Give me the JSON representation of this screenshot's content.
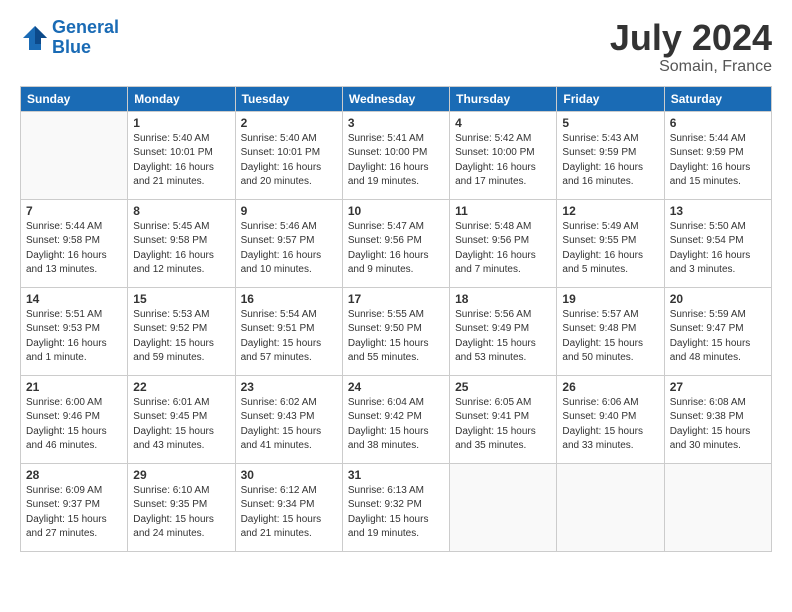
{
  "header": {
    "logo_line1": "General",
    "logo_line2": "Blue",
    "month_year": "July 2024",
    "location": "Somain, France"
  },
  "weekdays": [
    "Sunday",
    "Monday",
    "Tuesday",
    "Wednesday",
    "Thursday",
    "Friday",
    "Saturday"
  ],
  "weeks": [
    [
      {
        "day": "",
        "info": ""
      },
      {
        "day": "1",
        "info": "Sunrise: 5:40 AM\nSunset: 10:01 PM\nDaylight: 16 hours\nand 21 minutes."
      },
      {
        "day": "2",
        "info": "Sunrise: 5:40 AM\nSunset: 10:01 PM\nDaylight: 16 hours\nand 20 minutes."
      },
      {
        "day": "3",
        "info": "Sunrise: 5:41 AM\nSunset: 10:00 PM\nDaylight: 16 hours\nand 19 minutes."
      },
      {
        "day": "4",
        "info": "Sunrise: 5:42 AM\nSunset: 10:00 PM\nDaylight: 16 hours\nand 17 minutes."
      },
      {
        "day": "5",
        "info": "Sunrise: 5:43 AM\nSunset: 9:59 PM\nDaylight: 16 hours\nand 16 minutes."
      },
      {
        "day": "6",
        "info": "Sunrise: 5:44 AM\nSunset: 9:59 PM\nDaylight: 16 hours\nand 15 minutes."
      }
    ],
    [
      {
        "day": "7",
        "info": "Sunrise: 5:44 AM\nSunset: 9:58 PM\nDaylight: 16 hours\nand 13 minutes."
      },
      {
        "day": "8",
        "info": "Sunrise: 5:45 AM\nSunset: 9:58 PM\nDaylight: 16 hours\nand 12 minutes."
      },
      {
        "day": "9",
        "info": "Sunrise: 5:46 AM\nSunset: 9:57 PM\nDaylight: 16 hours\nand 10 minutes."
      },
      {
        "day": "10",
        "info": "Sunrise: 5:47 AM\nSunset: 9:56 PM\nDaylight: 16 hours\nand 9 minutes."
      },
      {
        "day": "11",
        "info": "Sunrise: 5:48 AM\nSunset: 9:56 PM\nDaylight: 16 hours\nand 7 minutes."
      },
      {
        "day": "12",
        "info": "Sunrise: 5:49 AM\nSunset: 9:55 PM\nDaylight: 16 hours\nand 5 minutes."
      },
      {
        "day": "13",
        "info": "Sunrise: 5:50 AM\nSunset: 9:54 PM\nDaylight: 16 hours\nand 3 minutes."
      }
    ],
    [
      {
        "day": "14",
        "info": "Sunrise: 5:51 AM\nSunset: 9:53 PM\nDaylight: 16 hours\nand 1 minute."
      },
      {
        "day": "15",
        "info": "Sunrise: 5:53 AM\nSunset: 9:52 PM\nDaylight: 15 hours\nand 59 minutes."
      },
      {
        "day": "16",
        "info": "Sunrise: 5:54 AM\nSunset: 9:51 PM\nDaylight: 15 hours\nand 57 minutes."
      },
      {
        "day": "17",
        "info": "Sunrise: 5:55 AM\nSunset: 9:50 PM\nDaylight: 15 hours\nand 55 minutes."
      },
      {
        "day": "18",
        "info": "Sunrise: 5:56 AM\nSunset: 9:49 PM\nDaylight: 15 hours\nand 53 minutes."
      },
      {
        "day": "19",
        "info": "Sunrise: 5:57 AM\nSunset: 9:48 PM\nDaylight: 15 hours\nand 50 minutes."
      },
      {
        "day": "20",
        "info": "Sunrise: 5:59 AM\nSunset: 9:47 PM\nDaylight: 15 hours\nand 48 minutes."
      }
    ],
    [
      {
        "day": "21",
        "info": "Sunrise: 6:00 AM\nSunset: 9:46 PM\nDaylight: 15 hours\nand 46 minutes."
      },
      {
        "day": "22",
        "info": "Sunrise: 6:01 AM\nSunset: 9:45 PM\nDaylight: 15 hours\nand 43 minutes."
      },
      {
        "day": "23",
        "info": "Sunrise: 6:02 AM\nSunset: 9:43 PM\nDaylight: 15 hours\nand 41 minutes."
      },
      {
        "day": "24",
        "info": "Sunrise: 6:04 AM\nSunset: 9:42 PM\nDaylight: 15 hours\nand 38 minutes."
      },
      {
        "day": "25",
        "info": "Sunrise: 6:05 AM\nSunset: 9:41 PM\nDaylight: 15 hours\nand 35 minutes."
      },
      {
        "day": "26",
        "info": "Sunrise: 6:06 AM\nSunset: 9:40 PM\nDaylight: 15 hours\nand 33 minutes."
      },
      {
        "day": "27",
        "info": "Sunrise: 6:08 AM\nSunset: 9:38 PM\nDaylight: 15 hours\nand 30 minutes."
      }
    ],
    [
      {
        "day": "28",
        "info": "Sunrise: 6:09 AM\nSunset: 9:37 PM\nDaylight: 15 hours\nand 27 minutes."
      },
      {
        "day": "29",
        "info": "Sunrise: 6:10 AM\nSunset: 9:35 PM\nDaylight: 15 hours\nand 24 minutes."
      },
      {
        "day": "30",
        "info": "Sunrise: 6:12 AM\nSunset: 9:34 PM\nDaylight: 15 hours\nand 21 minutes."
      },
      {
        "day": "31",
        "info": "Sunrise: 6:13 AM\nSunset: 9:32 PM\nDaylight: 15 hours\nand 19 minutes."
      },
      {
        "day": "",
        "info": ""
      },
      {
        "day": "",
        "info": ""
      },
      {
        "day": "",
        "info": ""
      }
    ]
  ]
}
